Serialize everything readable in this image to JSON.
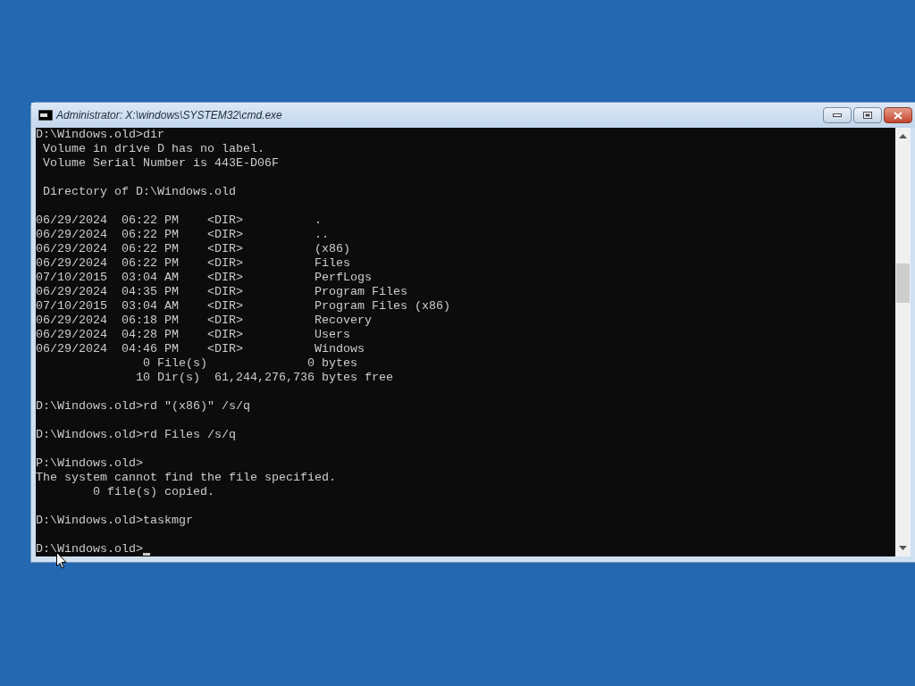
{
  "window": {
    "title": "Administrator: X:\\windows\\SYSTEM32\\cmd.exe"
  },
  "console_blocks": [
    [
      "D:\\Windows.old>dir",
      " Volume in drive D has no label.",
      " Volume Serial Number is 443E-D06F"
    ],
    [
      " Directory of D:\\Windows.old"
    ],
    [
      "06/29/2024  06:22 PM    <DIR>          .",
      "06/29/2024  06:22 PM    <DIR>          ..",
      "06/29/2024  06:22 PM    <DIR>          (x86)",
      "06/29/2024  06:22 PM    <DIR>          Files",
      "07/10/2015  03:04 AM    <DIR>          PerfLogs",
      "06/29/2024  04:35 PM    <DIR>          Program Files",
      "07/10/2015  03:04 AM    <DIR>          Program Files (x86)",
      "06/29/2024  06:18 PM    <DIR>          Recovery",
      "06/29/2024  04:28 PM    <DIR>          Users",
      "06/29/2024  04:46 PM    <DIR>          Windows",
      "               0 File(s)              0 bytes",
      "              10 Dir(s)  61,244,276,736 bytes free"
    ],
    [
      "D:\\Windows.old>rd \"(x86)\" /s/q"
    ],
    [
      "D:\\Windows.old>rd Files /s/q"
    ],
    [
      "P:\\Windows.old>",
      "The system cannot find the file specified.",
      "        0 file(s) copied."
    ],
    [
      "D:\\Windows.old>taskmgr"
    ],
    [
      "D:\\Windows.old>"
    ]
  ]
}
